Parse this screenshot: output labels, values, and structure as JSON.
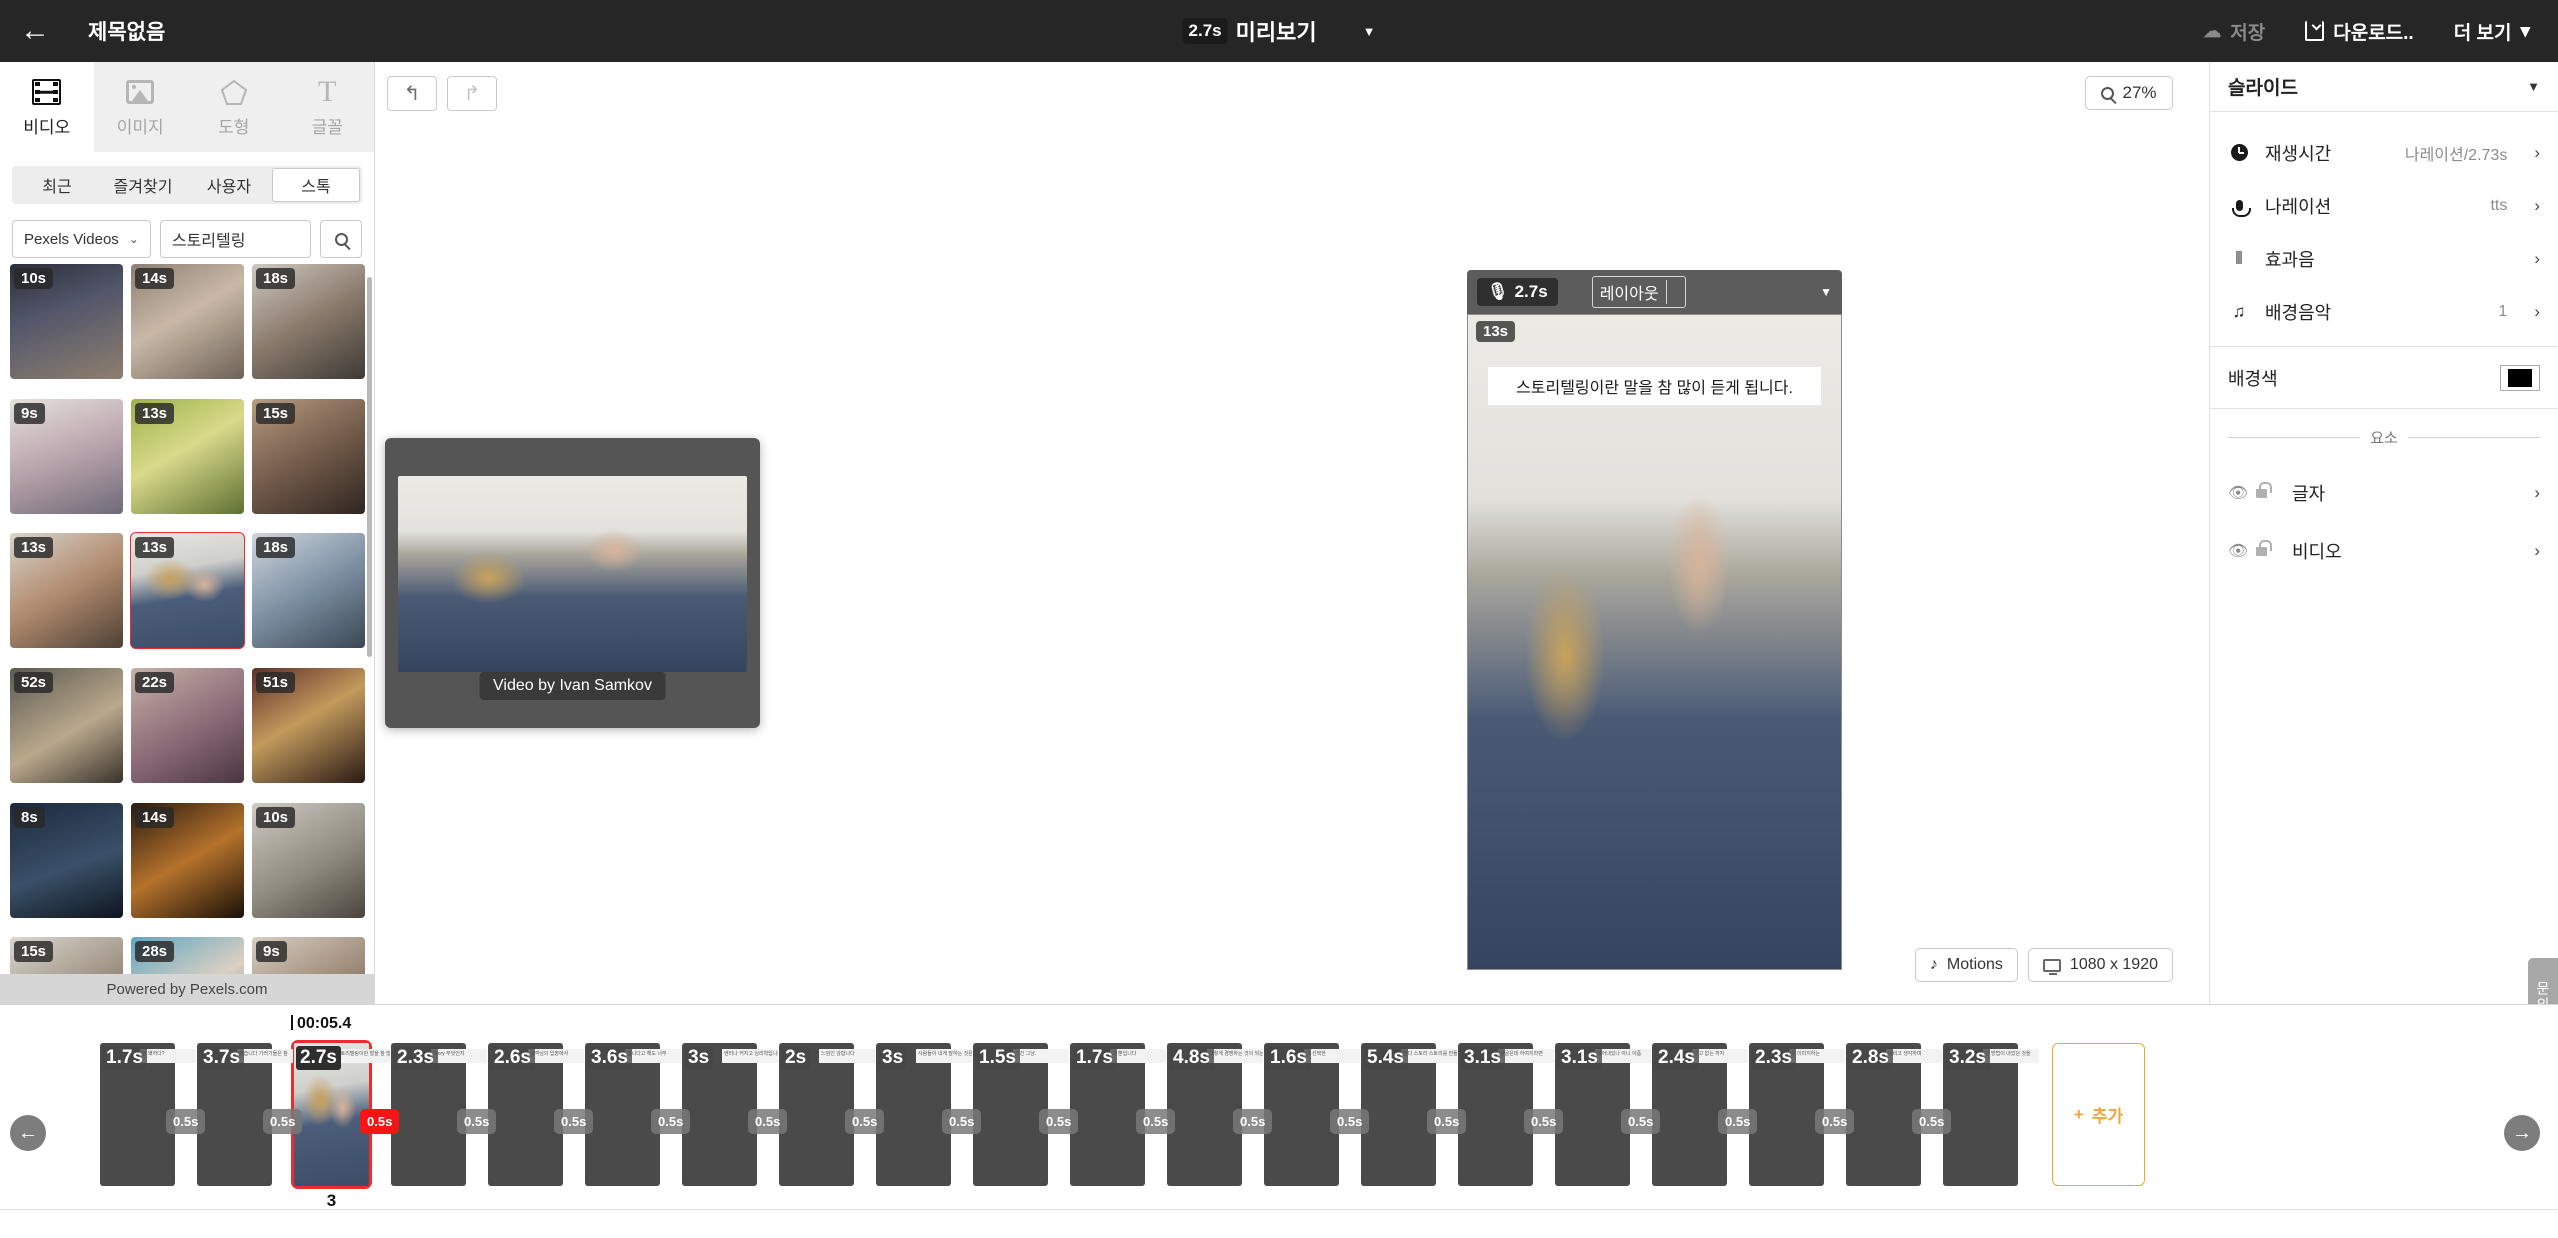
{
  "topbar": {
    "back_icon": "arrow-left-icon",
    "title": "제목없음",
    "preview_duration": "2.7s",
    "preview_label": "미리보기",
    "preview_caret": "▼",
    "save_label": "저장",
    "download_label": "다운로드..",
    "more_label": "더 보기",
    "more_caret": "▾"
  },
  "left_panel": {
    "tabs": [
      {
        "label": "비디오",
        "icon": "film-icon",
        "active": true
      },
      {
        "label": "이미지",
        "icon": "image-icon",
        "active": false
      },
      {
        "label": "도형",
        "icon": "pentagon-icon",
        "active": false
      },
      {
        "label": "글꼴",
        "icon": "text-icon",
        "active": false
      }
    ],
    "subtabs": [
      {
        "label": "최근",
        "selected": false
      },
      {
        "label": "즐겨찾기",
        "selected": false
      },
      {
        "label": "사용자",
        "selected": false
      },
      {
        "label": "스톡",
        "selected": true
      }
    ],
    "source_select": "Pexels Videos",
    "source_caret": "⌄",
    "search_value": "스토리텔링",
    "search_placeholder": "",
    "search_icon": "search-icon",
    "thumbnails": [
      {
        "duration": "10s",
        "style": "ph-a",
        "selected": false
      },
      {
        "duration": "14s",
        "style": "ph-b",
        "selected": false
      },
      {
        "duration": "18s",
        "style": "ph-c",
        "selected": false
      },
      {
        "duration": "9s",
        "style": "ph-d",
        "selected": false
      },
      {
        "duration": "13s",
        "style": "ph-e",
        "selected": false
      },
      {
        "duration": "15s",
        "style": "ph-f",
        "selected": false
      },
      {
        "duration": "13s",
        "style": "ph-g",
        "selected": false
      },
      {
        "duration": "13s",
        "style": "ph-sel",
        "selected": true
      },
      {
        "duration": "18s",
        "style": "ph-h",
        "selected": false
      },
      {
        "duration": "52s",
        "style": "ph-i",
        "selected": false
      },
      {
        "duration": "22s",
        "style": "ph-j",
        "selected": false
      },
      {
        "duration": "51s",
        "style": "ph-k",
        "selected": false
      },
      {
        "duration": "8s",
        "style": "ph-l",
        "selected": false
      },
      {
        "duration": "14s",
        "style": "ph-m",
        "selected": false
      },
      {
        "duration": "10s",
        "style": "ph-n",
        "selected": false
      },
      {
        "duration": "15s",
        "style": "ph-o",
        "selected": false
      },
      {
        "duration": "28s",
        "style": "ph-p",
        "selected": false
      },
      {
        "duration": "9s",
        "style": "ph-q",
        "selected": false
      }
    ],
    "footer": "Powered by Pexels.com"
  },
  "canvas": {
    "undo_icon": "undo-icon",
    "redo_icon": "redo-icon",
    "zoom_icon": "search-icon",
    "zoom_level": "27%",
    "stage_toolbar": {
      "mic_icon": "microphone-icon",
      "duration": "2.7s",
      "layout_label": "레이아웃",
      "caret": "▼"
    },
    "stage": {
      "clip_duration": "13s",
      "caption": "스토리텔링이란 말을 참 많이 듣게 됩니다."
    },
    "bottom_chips": [
      {
        "label": "Motions",
        "icon": "music-note-icon"
      },
      {
        "label": "1080 x 1920",
        "icon": "monitor-icon"
      }
    ]
  },
  "preview_card": {
    "credit": "Video by Ivan Samkov"
  },
  "right_panel": {
    "title": "슬라이드",
    "caret": "▼",
    "rows": [
      {
        "label": "재생시간",
        "value": "나레이션/2.73s",
        "icon": "clock-icon",
        "arrow": "›"
      },
      {
        "label": "나레이션",
        "value": "tts",
        "icon": "microphone-icon",
        "arrow": "›"
      },
      {
        "label": "효과음",
        "value": "",
        "icon": "waveform-icon",
        "arrow": "›"
      },
      {
        "label": "배경음악",
        "value": "1",
        "icon": "music-note-icon",
        "arrow": "›"
      }
    ],
    "bgcolor_label": "배경색",
    "bgcolor_value": "#000000",
    "elements_divider": "요소",
    "elements": [
      {
        "label": "글자",
        "eye_icon": "eye-icon",
        "lock_icon": "unlock-icon",
        "arrow": "›"
      },
      {
        "label": "비디오",
        "eye_icon": "eye-icon",
        "lock_icon": "unlock-icon",
        "arrow": "›"
      }
    ],
    "help_tab": "문의"
  },
  "timeline": {
    "playhead_time": "00:05.4",
    "gap_label": "0.5s",
    "selected_index": 2,
    "selected_number": "3",
    "add_label": "추가",
    "add_icon": "plus-icon",
    "nav_left_icon": "arrow-left-icon",
    "nav_right_icon": "arrow-right-icon",
    "slides": [
      {
        "duration": "1.7s",
        "caption": "안 왜하다?"
      },
      {
        "duration": "3.7s",
        "caption": "했습니다 기러기들은 참"
      },
      {
        "duration": "2.7s",
        "caption": "스토리텔링이란 말을 참 많이 듣게 됩니다."
      },
      {
        "duration": "2.3s",
        "caption": "Story 무엇인지"
      },
      {
        "duration": "2.6s",
        "caption": "고객님의 입장에서"
      },
      {
        "duration": "3.6s",
        "caption": "입니다고 해도 너무"
      },
      {
        "duration": "3s",
        "caption": "엔터나 커지고 심리학입니다"
      },
      {
        "duration": "2s",
        "caption": "느낌인 강합니다"
      },
      {
        "duration": "3s",
        "caption": "사람들이 내게 말하는 것은"
      },
      {
        "duration": "1.5s",
        "caption": "그건 그냥."
      },
      {
        "duration": "1.7s",
        "caption": "그 뿐입니다"
      },
      {
        "duration": "4.8s",
        "caption": "그렇게 경쟁하는 것이 되는지"
      },
      {
        "duration": "1.6s",
        "caption": "그 선택한"
      },
      {
        "duration": "5.4s",
        "caption": "한다 스토리 스토리를 만들었습니다."
      },
      {
        "duration": "3.1s",
        "caption": "시골은데 하여지라면"
      },
      {
        "duration": "3.1s",
        "caption": "되어내있나 아니 아픔"
      },
      {
        "duration": "2.4s",
        "caption": "가고 없는 까지"
      },
      {
        "duration": "2.3s",
        "caption": "모 이미지하는"
      },
      {
        "duration": "2.8s",
        "caption": "내비고 생각하며"
      },
      {
        "duration": "3.2s",
        "caption": "안 방법이 내었던 것을"
      }
    ]
  }
}
